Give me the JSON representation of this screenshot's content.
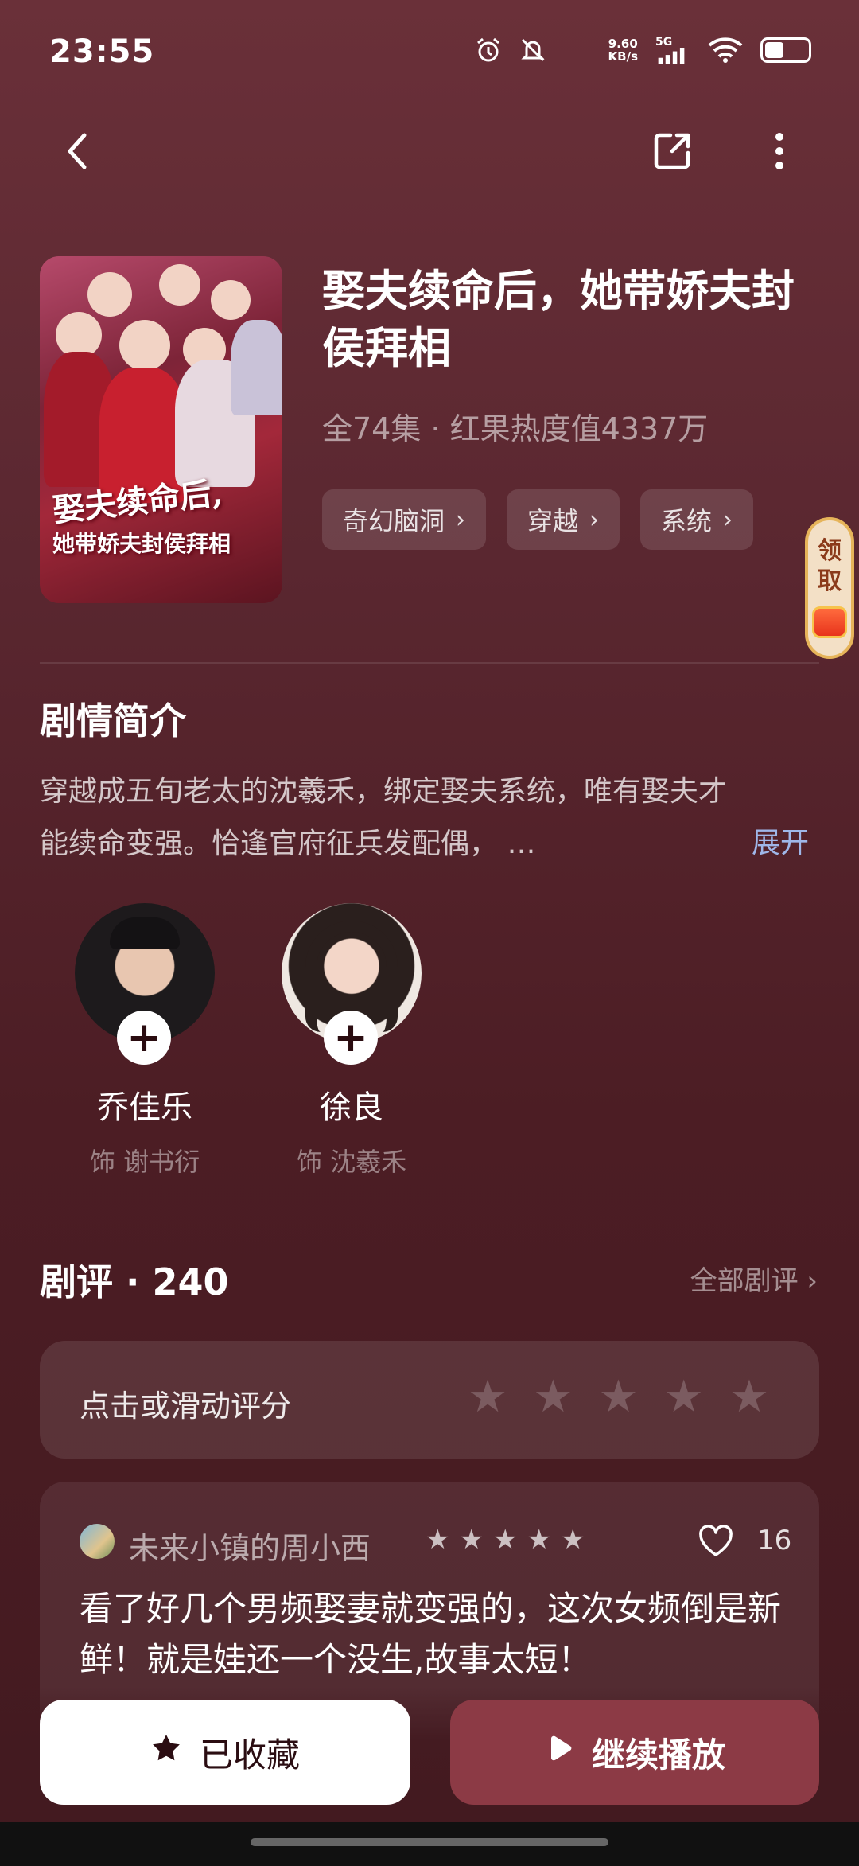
{
  "status_bar": {
    "time": "23:55",
    "net_speed_value": "9.60",
    "net_speed_unit": "KB/s",
    "network": "5G",
    "icons": [
      "alarm-icon",
      "mute-icon",
      "moon-icon",
      "signal-icon",
      "wifi-icon",
      "battery-icon"
    ]
  },
  "nav": {
    "back_icon": "back-icon",
    "share_icon": "share-icon",
    "more_icon": "more-icon"
  },
  "drama": {
    "title": "娶夫续命后，她带娇夫封侯拜相",
    "meta": "全74集 · 红果热度值4337万",
    "poster_title_line1": "娶夫续命后,",
    "poster_title_line2": "她带娇夫封侯拜相",
    "tags": [
      {
        "label": "奇幻脑洞"
      },
      {
        "label": "穿越"
      },
      {
        "label": "系统"
      }
    ]
  },
  "reward_badge": {
    "label_1": "领",
    "label_2": "取"
  },
  "synopsis": {
    "title": "剧情简介",
    "text": "穿越成五旬老太的沈羲禾，绑定娶夫系统，唯有娶夫才能续命变强。恰逢官府征兵发配偶， …",
    "expand_label": "展开"
  },
  "cast": [
    {
      "actor": "乔佳乐",
      "role": "饰 谢书衍"
    },
    {
      "actor": "徐良",
      "role": "饰 沈羲禾"
    }
  ],
  "reviews": {
    "title": "剧评 · 240",
    "all_label": "全部剧评",
    "rate_prompt": "点击或滑动评分",
    "rating_max": 5,
    "comment": {
      "user": "未来小镇的周小西",
      "stars": 5,
      "likes": "16",
      "text": "看了好几个男频娶妻就变强的，这次女频倒是新鲜！就是娃还一个没生,故事太短！"
    }
  },
  "actions": {
    "collect_label": "已收藏",
    "play_label": "继续播放"
  },
  "colors": {
    "background": "#5a2730",
    "play_button": "#8c3a45",
    "expand_link": "#9fb7e9"
  }
}
